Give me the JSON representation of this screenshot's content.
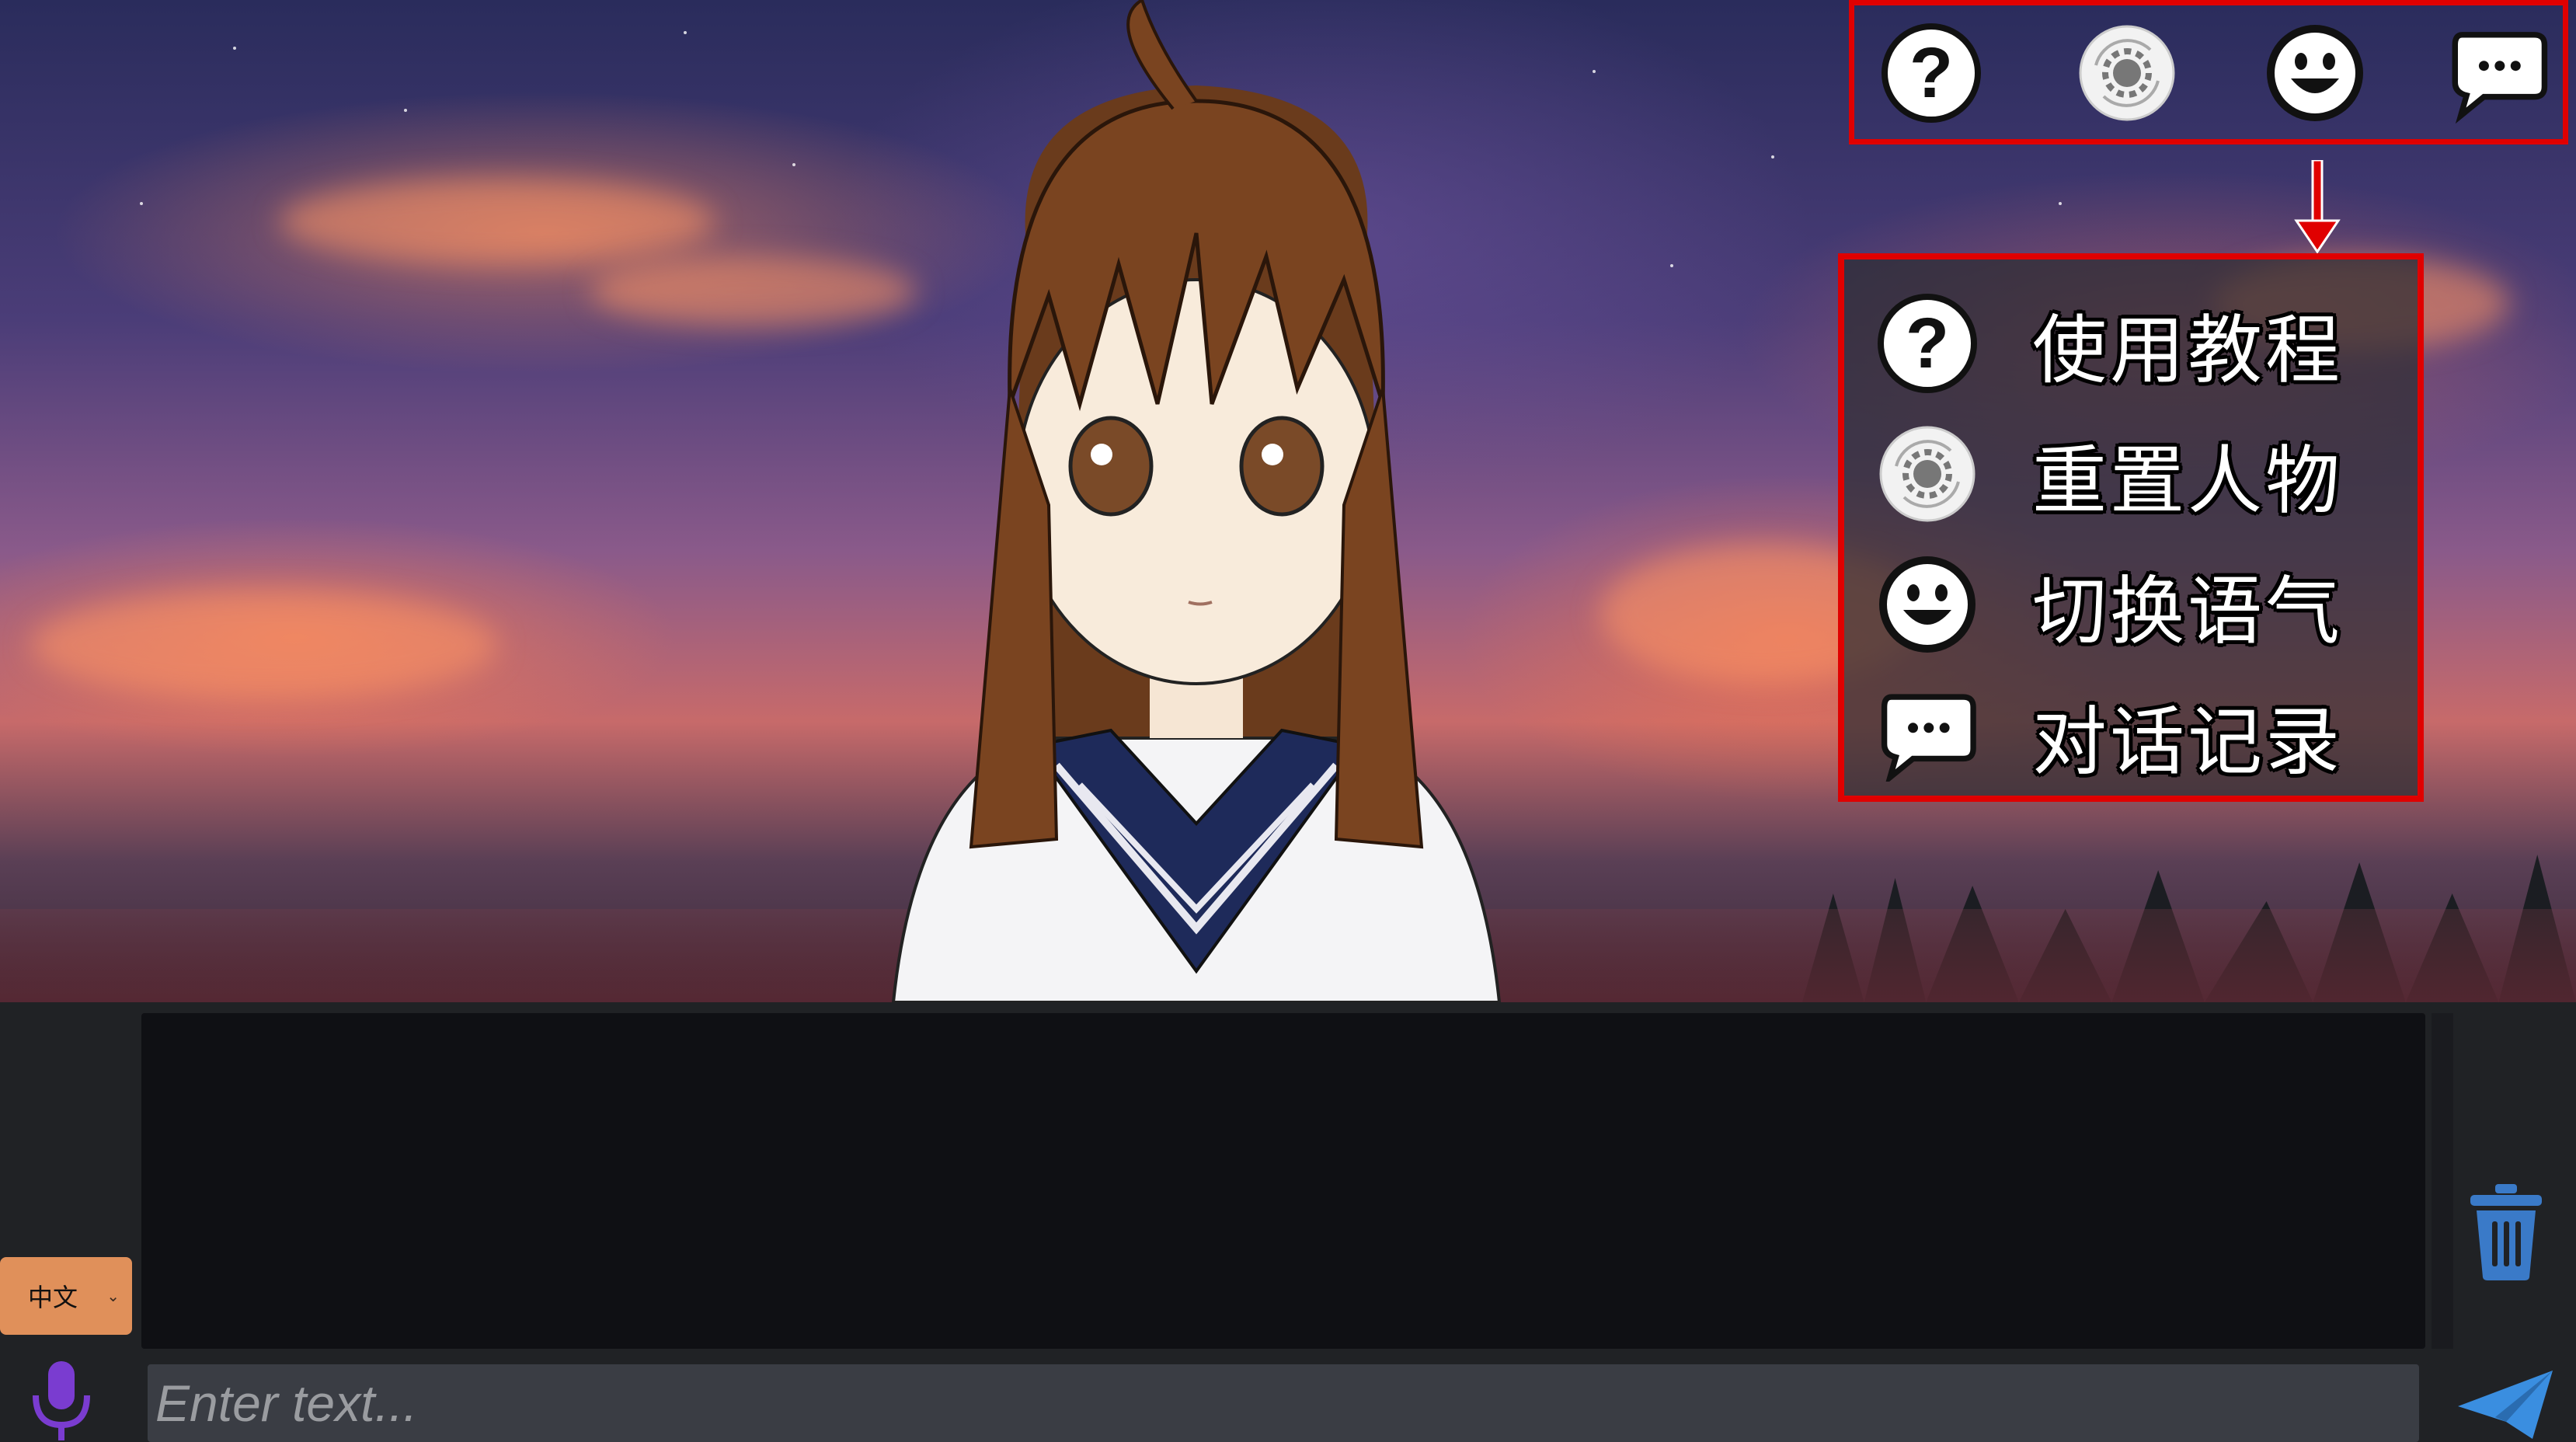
{
  "toolbar": {
    "buttons": [
      {
        "icon": "help-icon"
      },
      {
        "icon": "reset-character-icon"
      },
      {
        "icon": "emotion-icon"
      },
      {
        "icon": "chat-history-icon"
      }
    ]
  },
  "menu": {
    "items": [
      {
        "icon": "help-icon",
        "label": "使用教程"
      },
      {
        "icon": "reset-character-icon",
        "label": "重置人物"
      },
      {
        "icon": "emotion-icon",
        "label": "切换语气"
      },
      {
        "icon": "chat-history-icon",
        "label": "对话记录"
      }
    ]
  },
  "bottom": {
    "language": "中文",
    "input_placeholder": "Enter text...",
    "input_value": ""
  },
  "colors": {
    "highlight_border": "#e00000",
    "lang_button": "#e0905a",
    "mic": "#7a3cd0",
    "trash": "#3a7ac8",
    "send": "#3a8ee0"
  }
}
